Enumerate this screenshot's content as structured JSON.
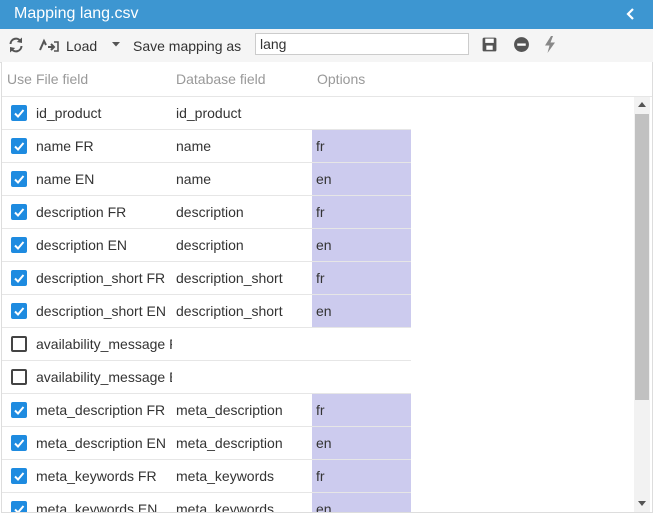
{
  "window": {
    "title": "Mapping lang.csv"
  },
  "toolbar": {
    "load_label": "Load",
    "save_as_label": "Save mapping as",
    "mapping_name_value": "lang"
  },
  "grid": {
    "headers": {
      "use": "Use",
      "file_field": "File field",
      "database_field": "Database field",
      "options": "Options"
    },
    "rows": [
      {
        "checked": true,
        "file_field": "id_product",
        "db_field": "id_product",
        "option": ""
      },
      {
        "checked": true,
        "file_field": "name FR",
        "db_field": "name",
        "option": "fr"
      },
      {
        "checked": true,
        "file_field": "name EN",
        "db_field": "name",
        "option": "en"
      },
      {
        "checked": true,
        "file_field": "description FR",
        "db_field": "description",
        "option": "fr"
      },
      {
        "checked": true,
        "file_field": "description EN",
        "db_field": "description",
        "option": "en"
      },
      {
        "checked": true,
        "file_field": "description_short FR",
        "db_field": "description_short",
        "option": "fr"
      },
      {
        "checked": true,
        "file_field": "description_short EN",
        "db_field": "description_short",
        "option": "en"
      },
      {
        "checked": false,
        "file_field": "availability_message FR",
        "db_field": "",
        "option": ""
      },
      {
        "checked": false,
        "file_field": "availability_message EN",
        "db_field": "",
        "option": ""
      },
      {
        "checked": true,
        "file_field": "meta_description FR",
        "db_field": "meta_description",
        "option": "fr"
      },
      {
        "checked": true,
        "file_field": "meta_description EN",
        "db_field": "meta_description",
        "option": "en"
      },
      {
        "checked": true,
        "file_field": "meta_keywords FR",
        "db_field": "meta_keywords",
        "option": "fr"
      },
      {
        "checked": true,
        "file_field": "meta_keywords EN",
        "db_field": "meta_keywords",
        "option": "en"
      }
    ]
  },
  "colors": {
    "title_bar": "#3d96d1",
    "checkbox_checked": "#1e8be0",
    "option_shade": "#cccbee"
  },
  "icons": {
    "refresh": "refresh-icon",
    "load": "load-icon",
    "dropdown": "chevron-down-icon",
    "save": "save-icon",
    "delete": "minus-circle-icon",
    "run": "lightning-icon",
    "collapse": "chevron-left-icon"
  }
}
